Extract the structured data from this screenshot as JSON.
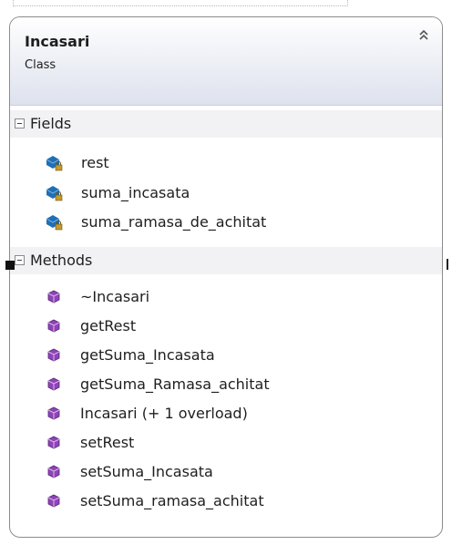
{
  "class_shape": {
    "title": "Incasari",
    "subtitle": "Class",
    "collapse_icon": "double-chevron-up-icon"
  },
  "sections": {
    "fields": {
      "label": "Fields",
      "items": [
        {
          "name": "rest",
          "icon": "private-field-icon"
        },
        {
          "name": "suma_incasata",
          "icon": "private-field-icon"
        },
        {
          "name": "suma_ramasa_de_achitat",
          "icon": "private-field-icon"
        }
      ]
    },
    "methods": {
      "label": "Methods",
      "items": [
        {
          "name": "~Incasari",
          "icon": "method-icon"
        },
        {
          "name": "getRest",
          "icon": "method-icon"
        },
        {
          "name": "getSuma_Incasata",
          "icon": "method-icon"
        },
        {
          "name": "getSuma_Ramasa_achitat",
          "icon": "method-icon"
        },
        {
          "name": "Incasari (+ 1 overload)",
          "icon": "method-icon"
        },
        {
          "name": "setRest",
          "icon": "method-icon"
        },
        {
          "name": "setSuma_Incasata",
          "icon": "method-icon"
        },
        {
          "name": "setSuma_ramasa_achitat",
          "icon": "method-icon"
        }
      ]
    }
  },
  "colors": {
    "field_icon": "#1f6fb5",
    "lock": "#c49a2c",
    "method_icon": "#8e44b8",
    "border": "#8c8c8c",
    "header_gradient_end": "#dde2ee"
  }
}
